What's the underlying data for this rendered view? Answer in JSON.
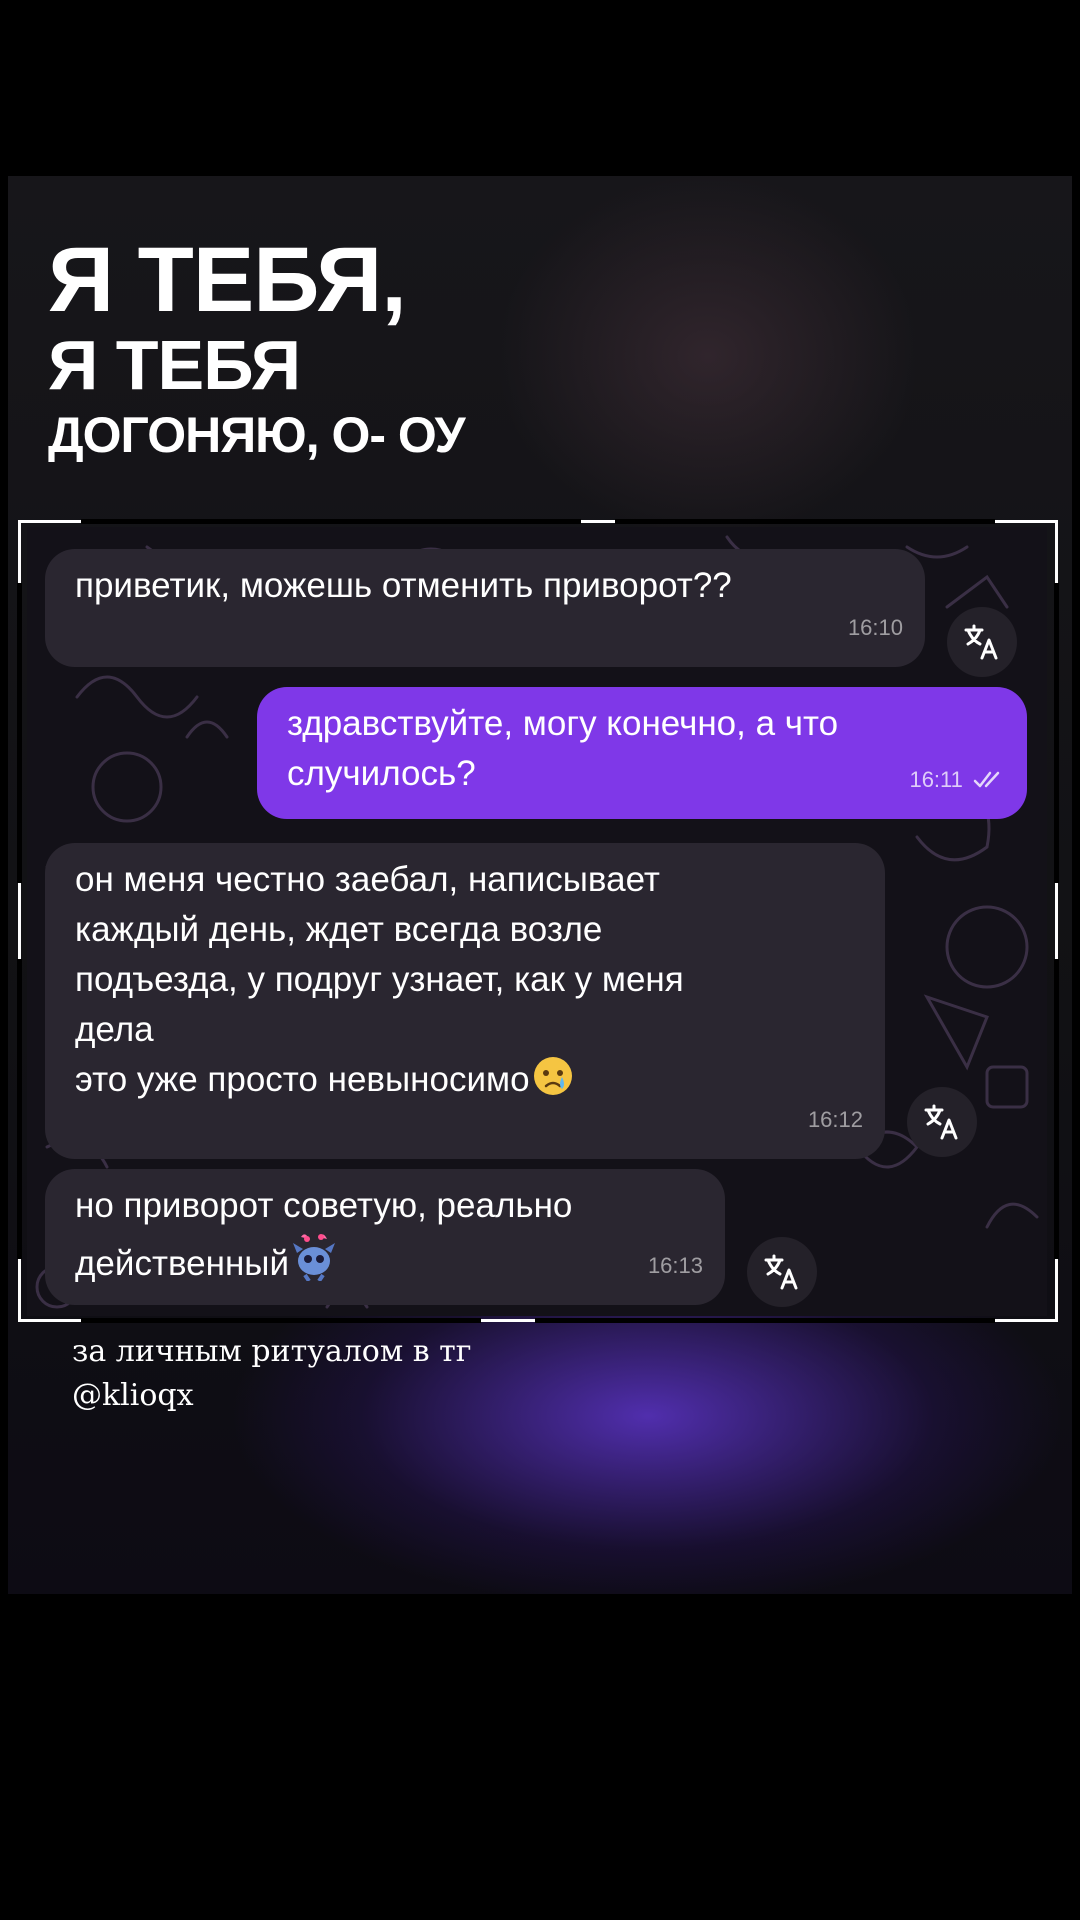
{
  "headline": {
    "line1": "Я ТЕБЯ,",
    "line2": "Я ТЕБЯ",
    "line3": "ДОГОНЯЮ, О- ОУ"
  },
  "messages": [
    {
      "direction": "incoming",
      "text": "приветик, можешь отменить приворот??",
      "time": "16:10",
      "translate_icon": "translate-icon"
    },
    {
      "direction": "outgoing",
      "text": "здравствуйте, могу конечно, а что\nслучилось?",
      "time": "16:11",
      "status": "read-double-check"
    },
    {
      "direction": "incoming",
      "text": "он меня честно заебал, написывает\nкаждый день, ждет всегда возле\nподъезда, у подруг узнает, как у меня\nдела\nэто уже просто невыносимо",
      "emoji": "crying-face-emoji",
      "time": "16:12",
      "translate_icon": "translate-icon"
    },
    {
      "direction": "incoming",
      "text": "но приворот советую, реально\nдейственный",
      "emoji": "stitch-sticker-emoji",
      "time": "16:13",
      "translate_icon": "translate-icon"
    }
  ],
  "caption": {
    "line1": "за личным ритуалом в тг",
    "line2": "@klioqx"
  },
  "colors": {
    "outgoing_bubble": "#7f38e8",
    "incoming_bubble": "#2a2630",
    "glow": "#5c34c8"
  }
}
